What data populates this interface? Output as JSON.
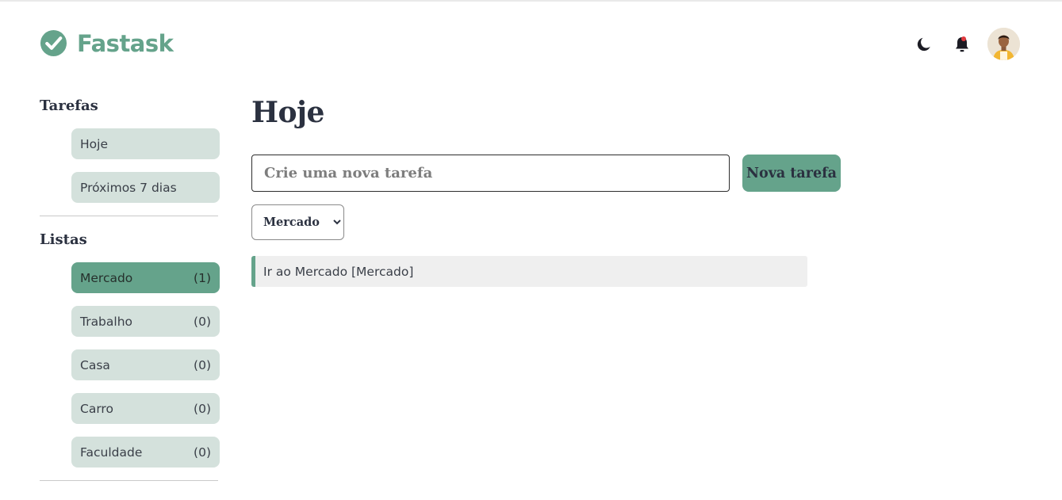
{
  "app": {
    "name": "Fastask",
    "brand_color": "#65a38b"
  },
  "header": {
    "icons": [
      "moon-icon",
      "bell-icon",
      "avatar"
    ]
  },
  "sidebar": {
    "tarefas_title": "Tarefas",
    "tarefas": [
      {
        "label": "Hoje"
      },
      {
        "label": "Próximos 7 dias"
      }
    ],
    "listas_title": "Listas",
    "listas": [
      {
        "label": "Mercado",
        "count": "(1)",
        "active": true
      },
      {
        "label": "Trabalho",
        "count": "(0)"
      },
      {
        "label": "Casa",
        "count": "(0)"
      },
      {
        "label": "Carro",
        "count": "(0)"
      },
      {
        "label": "Faculdade",
        "count": "(0)"
      }
    ]
  },
  "main": {
    "title": "Hoje",
    "new_task": {
      "placeholder": "Crie uma nova tarefa",
      "value": ""
    },
    "new_task_button": "Nova tarefa",
    "list_select": {
      "selected": "Mercado",
      "options": [
        "Mercado"
      ]
    },
    "tasks": [
      {
        "text": "Ir ao Mercado [Mercado]"
      }
    ]
  }
}
